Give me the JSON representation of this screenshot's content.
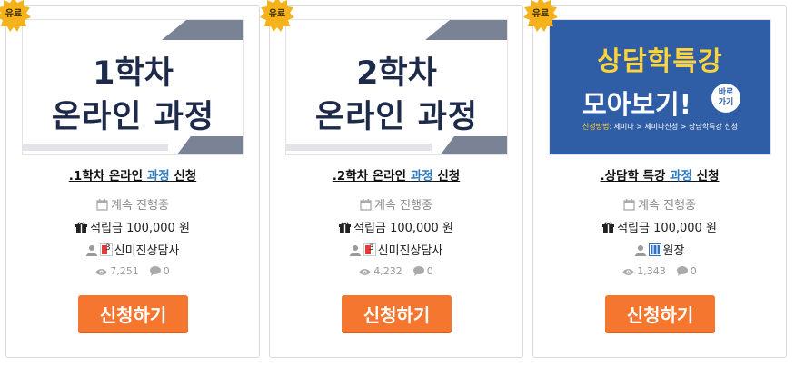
{
  "cards": [
    {
      "badge": "유료",
      "thumb_line1": "1학차",
      "thumb_line2": "온라인 과정",
      "title_pre": ".1학차 온라인 ",
      "title_hl": "과정",
      "title_post": " 신청",
      "status": "계속 진행중",
      "points": "적립금 100,000 원",
      "author": "신미진상담사",
      "views": "7,251",
      "comments": "0",
      "button": "신청하기"
    },
    {
      "badge": "유료",
      "thumb_line1": "2학차",
      "thumb_line2": "온라인 과정",
      "title_pre": ".2학차 온라인 ",
      "title_hl": "과정",
      "title_post": " 신청",
      "status": "계속 진행중",
      "points": "적립금 100,000 원",
      "author": "신미진상담사",
      "views": "4,232",
      "comments": "0",
      "button": "신청하기"
    },
    {
      "badge": "유료",
      "thumb_line1": "상담학특강",
      "thumb_line2": "모아보기!",
      "thumb_circle": "바로\n가기",
      "thumb_sub_key": "신청방법:",
      "thumb_sub": " 세미나 > 세미나신청 > 상담학특강 신청",
      "title_pre": ".상담학 특강 ",
      "title_hl": "과정",
      "title_post": " 신청",
      "status": "계속 진행중",
      "points": "적립금 100,000 원",
      "author": "원장",
      "views": "1,343",
      "comments": "0",
      "button": "신청하기"
    }
  ],
  "colors": {
    "accent_button": "#f5762f",
    "title_highlight": "#2f7cc1",
    "thumb_blue": "#2f5ea6",
    "thumb_yellow": "#ffd43a",
    "badge_gold": "#f5b21a"
  },
  "icons": {
    "status": "calendar-icon",
    "points": "gift-icon",
    "author": "user-icon",
    "views": "eye-icon",
    "comments": "comment-icon",
    "badge": "starburst-badge-icon"
  }
}
